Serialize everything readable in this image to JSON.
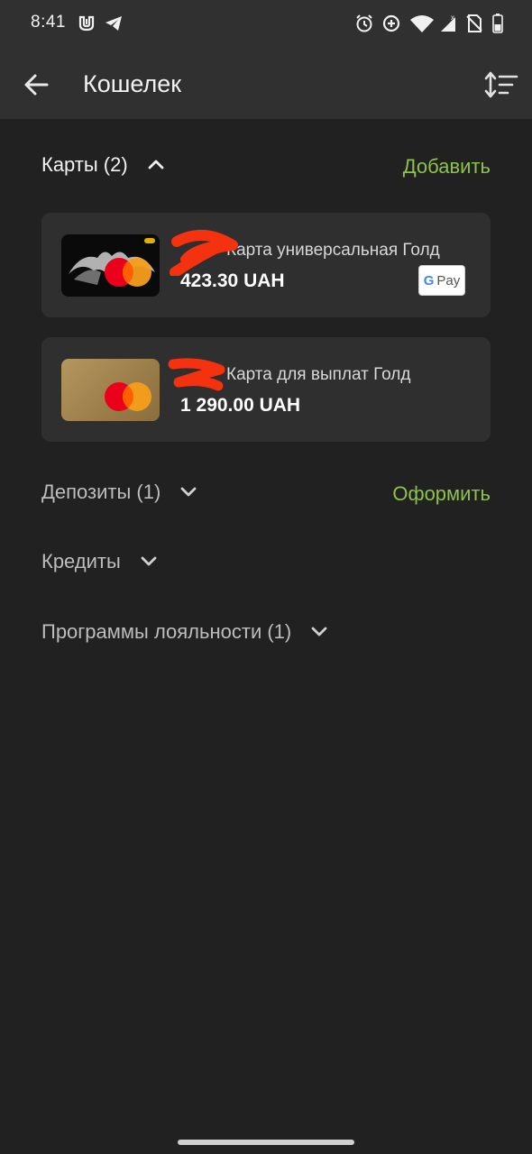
{
  "status_bar": {
    "time": "8:41"
  },
  "app_bar": {
    "title": "Кошелек"
  },
  "sections": {
    "cards": {
      "title": "Карты (2)",
      "action": "Добавить",
      "expanded": true
    },
    "deposits": {
      "title": "Депозиты (1)",
      "action": "Оформить",
      "expanded": false
    },
    "credits": {
      "title": "Кредиты",
      "expanded": false
    },
    "loyalty": {
      "title": "Программы лояльности (1)",
      "expanded": false
    }
  },
  "cards": [
    {
      "name": "Карта универсальная Голд",
      "amount": "423.30 UAH",
      "wallet_badge": {
        "g": "G",
        "pay": "Pay"
      }
    },
    {
      "name": "Карта для выплат Голд",
      "amount": "1 290.00 UAH"
    }
  ],
  "colors": {
    "background": "#212121",
    "bar": "#303030",
    "card": "#2f2f2f",
    "accent": "#8bc34a",
    "redaction": "#f4320f"
  }
}
